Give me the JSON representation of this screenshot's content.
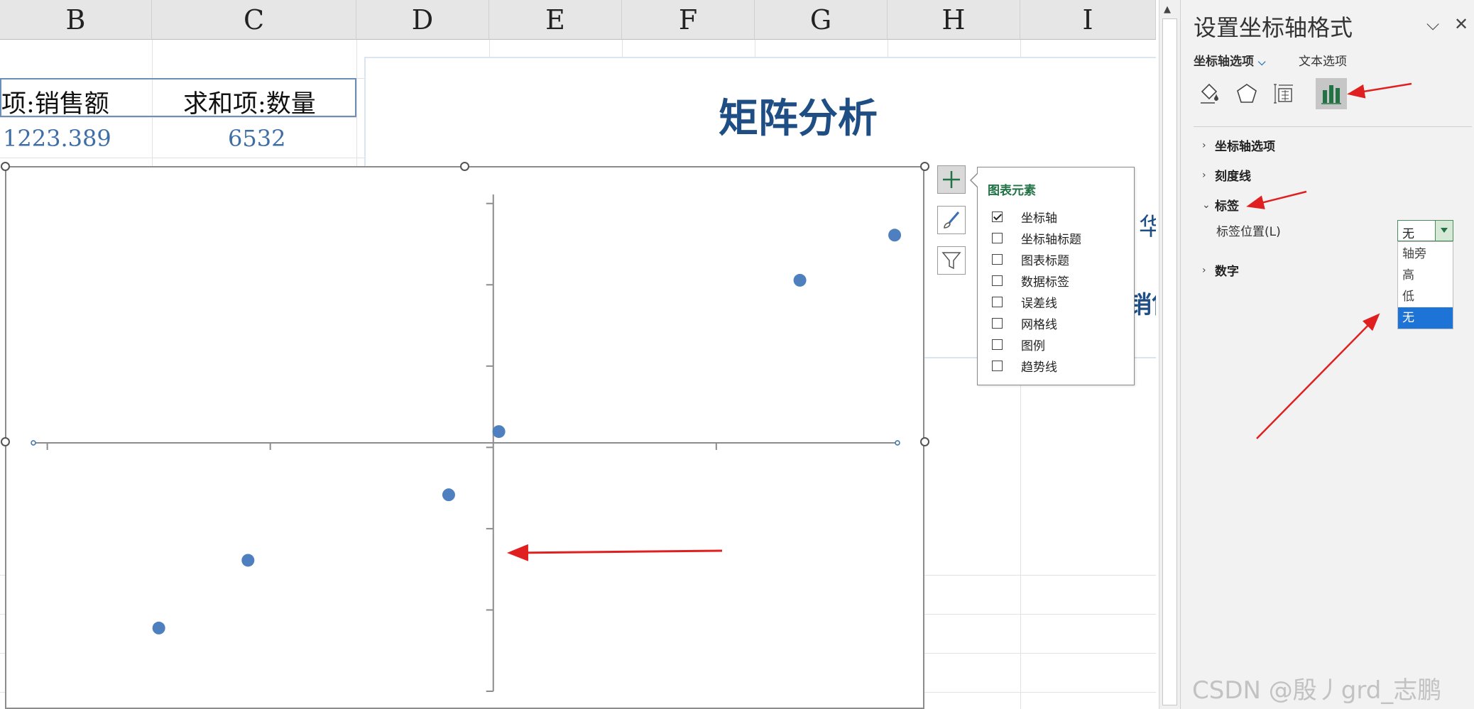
{
  "column_headers": [
    "B",
    "C",
    "D",
    "E",
    "F",
    "G",
    "H",
    "I"
  ],
  "sheet": {
    "header_row": [
      "项:销售额",
      "求和项:数量"
    ],
    "data_row": [
      "1223.389",
      "6532"
    ],
    "dashboard_title": "矩阵分析",
    "partial_text_1": "华",
    "partial_text_2": "销售"
  },
  "chart": {
    "points": [
      {
        "x": 7.2,
        "y": 9.2
      },
      {
        "x": 5.5,
        "y": 7.2
      },
      {
        "x": 0.1,
        "y": 0.5
      },
      {
        "x": -0.8,
        "y": -2.3
      },
      {
        "x": -4.4,
        "y": -5.2
      },
      {
        "x": -6.0,
        "y": -8.2
      }
    ],
    "xlim": [
      -8.25,
      7.25
    ],
    "ylim": [
      -11,
      11
    ],
    "marker_color": "#4e80bf",
    "axis_labels": "none"
  },
  "chart_elements_popup": {
    "title": "图表元素",
    "items": [
      {
        "label": "坐标轴",
        "checked": true
      },
      {
        "label": "坐标轴标题",
        "checked": false
      },
      {
        "label": "图表标题",
        "checked": false
      },
      {
        "label": "数据标签",
        "checked": false
      },
      {
        "label": "误差线",
        "checked": false
      },
      {
        "label": "网格线",
        "checked": false
      },
      {
        "label": "图例",
        "checked": false
      },
      {
        "label": "趋势线",
        "checked": false
      }
    ]
  },
  "side_buttons": [
    "plus-icon",
    "brush-icon",
    "filter-icon"
  ],
  "format_pane": {
    "title": "设置坐标轴格式",
    "tab_axis_options": "坐标轴选项",
    "tab_text_options": "文本选项",
    "icons": [
      "fill-line-icon",
      "effects-icon",
      "size-properties-icon",
      "axis-options-icon"
    ],
    "sections": [
      {
        "label": "坐标轴选项",
        "expanded": false
      },
      {
        "label": "刻度线",
        "expanded": false
      },
      {
        "label": "标签",
        "expanded": true
      },
      {
        "label": "数字",
        "expanded": false
      }
    ],
    "label_position_label": "标签位置(L)",
    "label_position_value": "无",
    "label_position_options": [
      "轴旁",
      "高",
      "低",
      "无"
    ],
    "label_position_selected": "无"
  },
  "watermark": "CSDN @殷丿grd_志鹏",
  "colors": {
    "accent_green": "#217346",
    "title_blue": "#1f4e85",
    "annotation_red": "#e02020",
    "selection_blue": "#1e73d6"
  }
}
